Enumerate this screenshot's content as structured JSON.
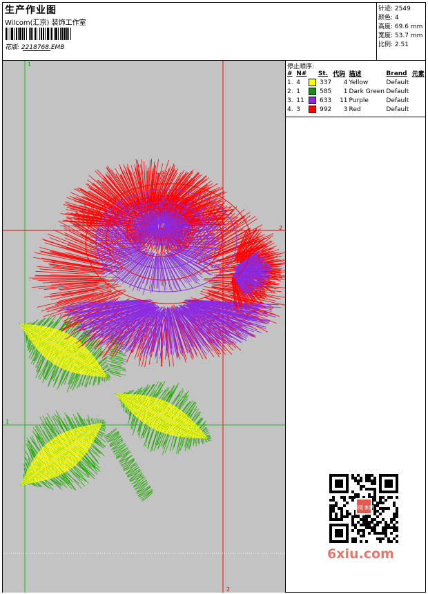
{
  "header": {
    "title": "生产作业图",
    "company": "Wilcom(汇京) 装饰工作室",
    "design_label": "花版:",
    "design_value": "2218768.EMB"
  },
  "stats": [
    {
      "label": "针迹:",
      "value": "2549"
    },
    {
      "label": "颜色:",
      "value": "4"
    },
    {
      "label": "高度:",
      "value": "69.6 mm"
    },
    {
      "label": "宽度:",
      "value": "53.7 mm"
    },
    {
      "label": "比例:",
      "value": "2.51"
    }
  ],
  "sequence": {
    "title": "停止顺序:",
    "headers": [
      "#",
      "N#",
      "St.",
      "代码",
      "描述",
      "Brand",
      "元素"
    ],
    "rows": [
      {
        "idx": "1.",
        "num": "4",
        "color": "#ffff00",
        "st": "337",
        "code": "4",
        "desc": "Yellow",
        "brand": "Default"
      },
      {
        "idx": "2.",
        "num": "1",
        "color": "#1a8a1a",
        "st": "585",
        "code": "1",
        "desc": "Dark Green",
        "brand": "Default"
      },
      {
        "idx": "3.",
        "num": "11",
        "color": "#8a2be2",
        "st": "633",
        "code": "11",
        "desc": "Purple",
        "brand": "Default"
      },
      {
        "idx": "4.",
        "num": "3",
        "color": "#ff0000",
        "st": "992",
        "code": "3",
        "desc": "Red",
        "brand": "Default"
      }
    ]
  },
  "canvas": {
    "guide_labels": [
      "1",
      "2",
      "1",
      "2"
    ],
    "colors": {
      "background": "#c3c3c3",
      "green_guide": "#00cc00",
      "red_guide": "#ff0000"
    }
  },
  "watermark": "6xiu.com",
  "qr_badge": "订阅 刺绣"
}
